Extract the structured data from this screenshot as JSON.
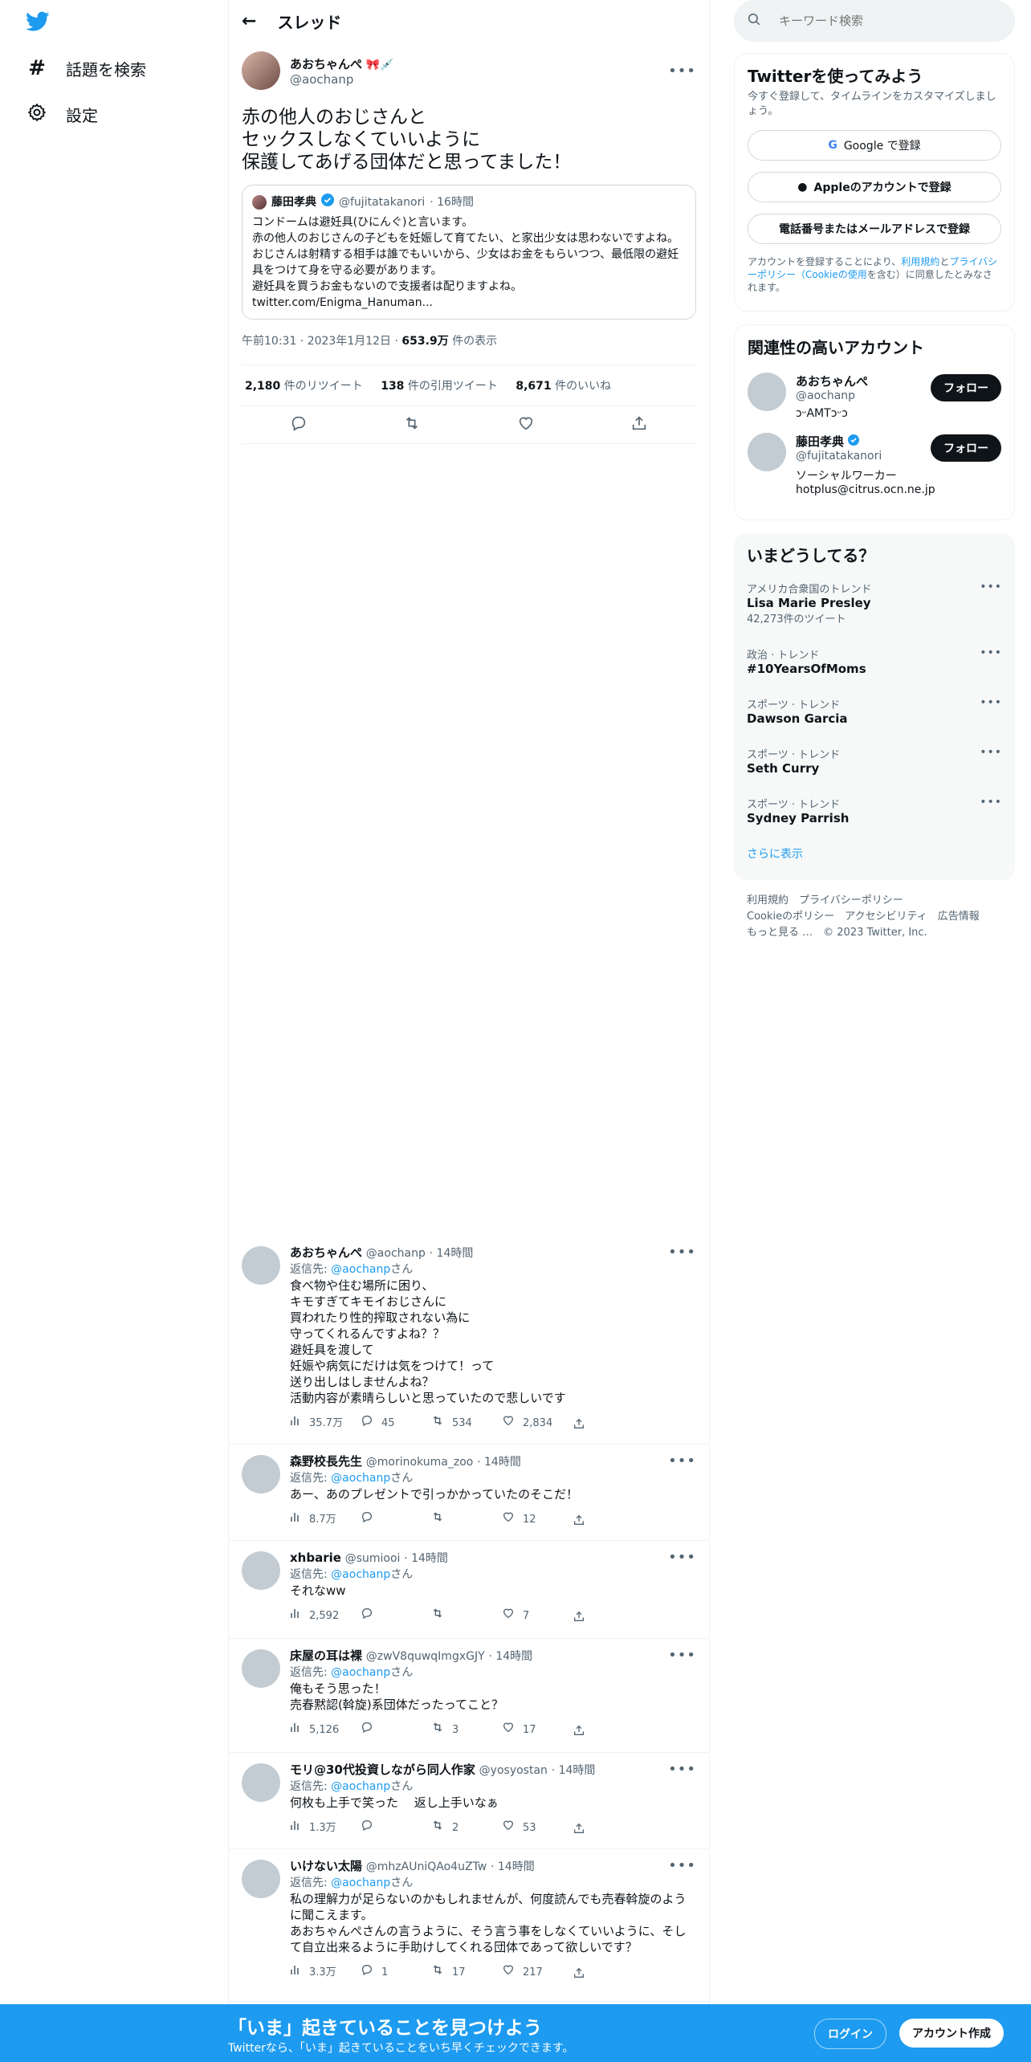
{
  "nav": {
    "explore": "話題を検索",
    "settings": "設定"
  },
  "header": {
    "title": "スレッド"
  },
  "tweet": {
    "name": "あおちゃんぺ",
    "handle": "@aochanp",
    "text": "赤の他人のおじさんと\nセックスしなくていいように\n保護してあげる団体だと思ってました！",
    "quote": {
      "name": "藤田孝典",
      "handle": "@fujitatakanori",
      "time": "· 16時間",
      "text": "コンドームは避妊具(ひにんぐ)と言います。\n赤の他人のおじさんの子どもを妊娠して育てたい、と家出少女は思わないですよね。\nおじさんは射精する相手は誰でもいいから、少女はお金をもらいつつ、最低限の避妊具をつけて身を守る必要があります。\n避妊具を買うお金もないので支援者は配りますよね。\ntwitter.com/Enigma_Hanuman..."
    },
    "time": "午前10:31 · 2023年1月12日 · ",
    "views_num": "653.9万",
    "views_label": " 件の表示",
    "retweets_num": "2,180",
    "retweets_label": " 件のリツイート",
    "quotes_num": "138",
    "quotes_label": " 件の引用ツイート",
    "likes_num": "8,671",
    "likes_label": " 件のいいね"
  },
  "replies": [
    {
      "name": "あおちゃんぺ",
      "handle": "@aochanp",
      "time": "· 14時間",
      "reply_to": "@aochanp",
      "reply_prefix": "返信先: ",
      "reply_suffix": "さん",
      "text": "食べ物や住む場所に困り、\nキモすぎてキモイおじさんに\n買われたり性的搾取されない為に\n守ってくれるんですよね？？\n避妊具を渡して\n妊娠や病気にだけは気をつけて！って\n送り出しはしませんよね？\n活動内容が素晴らしいと思っていたので悲しいです",
      "views": "35.7万",
      "replies": "45",
      "retweets": "534",
      "likes": "2,834"
    },
    {
      "name": "森野校長先生",
      "handle": "@morinokuma_zoo",
      "time": "· 14時間",
      "reply_to": "@aochanp",
      "reply_prefix": "返信先: ",
      "reply_suffix": "さん",
      "text": "あー、あのプレゼントで引っかかっていたのそこだ！",
      "views": "8.7万",
      "replies": "",
      "retweets": "",
      "likes": "12"
    },
    {
      "name": "xhbarie",
      "handle": "@sumiooi",
      "time": "· 14時間",
      "reply_to": "@aochanp",
      "reply_prefix": "返信先: ",
      "reply_suffix": "さん",
      "text": "それなww",
      "views": "2,592",
      "replies": "",
      "retweets": "",
      "likes": "7"
    },
    {
      "name": "床屋の耳は裸",
      "handle": "@zwV8quwqImgxGJY",
      "time": "· 14時間",
      "reply_to": "@aochanp",
      "reply_prefix": "返信先: ",
      "reply_suffix": "さん",
      "text": "俺もそう思った！\n売春黙認(斡旋)系団体だったってこと？",
      "views": "5,126",
      "replies": "",
      "retweets": "3",
      "likes": "17"
    },
    {
      "name": "モリ@30代投資しながら同人作家",
      "handle": "@yosyostan",
      "time": "· 14時間",
      "reply_to": "@aochanp",
      "reply_prefix": "返信先: ",
      "reply_suffix": "さん",
      "text": "何枚も上手で笑った　 返し上手いなぁ",
      "views": "1.3万",
      "replies": "",
      "retweets": "2",
      "likes": "53"
    },
    {
      "name": "いけない太陽",
      "handle": "@mhzAUniQAo4uZTw",
      "time": "· 14時間",
      "reply_to": "@aochanp",
      "reply_prefix": "返信先: ",
      "reply_suffix": "さん",
      "text": "私の理解力が足らないのかもしれませんが、何度読んでも売春斡旋のように聞こえます。\nあおちゃんぺさんの言うように、そう言う事をしなくていいように、そして自立出来るように手助けしてくれる団体であって欲しいです？",
      "views": "3.3万",
      "replies": "1",
      "retweets": "17",
      "likes": "217"
    }
  ],
  "search": {
    "placeholder": "キーワード検索"
  },
  "signup": {
    "title": "Twitterを使ってみよう",
    "desc": "今すぐ登録して、タイムラインをカスタマイズしましょう。",
    "google": "Google で登録",
    "apple": "Appleのアカウントで登録",
    "phone": "電話番号またはメールアドレスで登録",
    "terms_a": "アカウントを登録することにより、",
    "terms_link1": "利用規約",
    "terms_b": "と",
    "terms_link2": "プライバシーポリシー（Cookieの使用",
    "terms_c": "を含む）に同意したとみなされます。"
  },
  "related": {
    "title": "関連性の高いアカウント",
    "accounts": [
      {
        "name": "あおちゃんぺ",
        "handle": "@aochanp",
        "bio": "ɔᵕAMTɔᵕɔ",
        "follow": "フォロー"
      },
      {
        "name": "藤田孝典",
        "handle": "@fujitatakanori",
        "bio": "ソーシャルワーカー\nhotplus@citrus.ocn.ne.jp",
        "follow": "フォロー"
      }
    ]
  },
  "trends": {
    "title": "いまどうしてる？",
    "items": [
      {
        "context": "アメリカ合衆国のトレンド",
        "topic": "Lisa Marie Presley",
        "count": "42,273件のツイート"
      },
      {
        "context": "政治 · トレンド",
        "topic": "#10YearsOfMoms",
        "count": ""
      },
      {
        "context": "スポーツ · トレンド",
        "topic": "Dawson Garcia",
        "count": ""
      },
      {
        "context": "スポーツ · トレンド",
        "topic": "Seth Curry",
        "count": ""
      },
      {
        "context": "スポーツ · トレンド",
        "topic": "Sydney Parrish",
        "count": ""
      }
    ],
    "more": "さらに表示"
  },
  "footer": {
    "l1a": "利用規約",
    "l1b": "プライバシーポリシー",
    "l2a": "Cookieのポリシー",
    "l2b": "アクセシビリティ",
    "l2c": "広告情報",
    "l3a": "もっと見る …",
    "l3b": "© 2023 Twitter, Inc."
  },
  "bottom": {
    "title": "「いま」起きていることを見つけよう",
    "sub": "Twitterなら、「いま」起きていることをいち早くチェックできます。",
    "login": "ログイン",
    "signup": "アカウント作成"
  },
  "colors": {
    "accent": "#1d9bf0",
    "text": "#0f1419",
    "muted": "#536471"
  }
}
